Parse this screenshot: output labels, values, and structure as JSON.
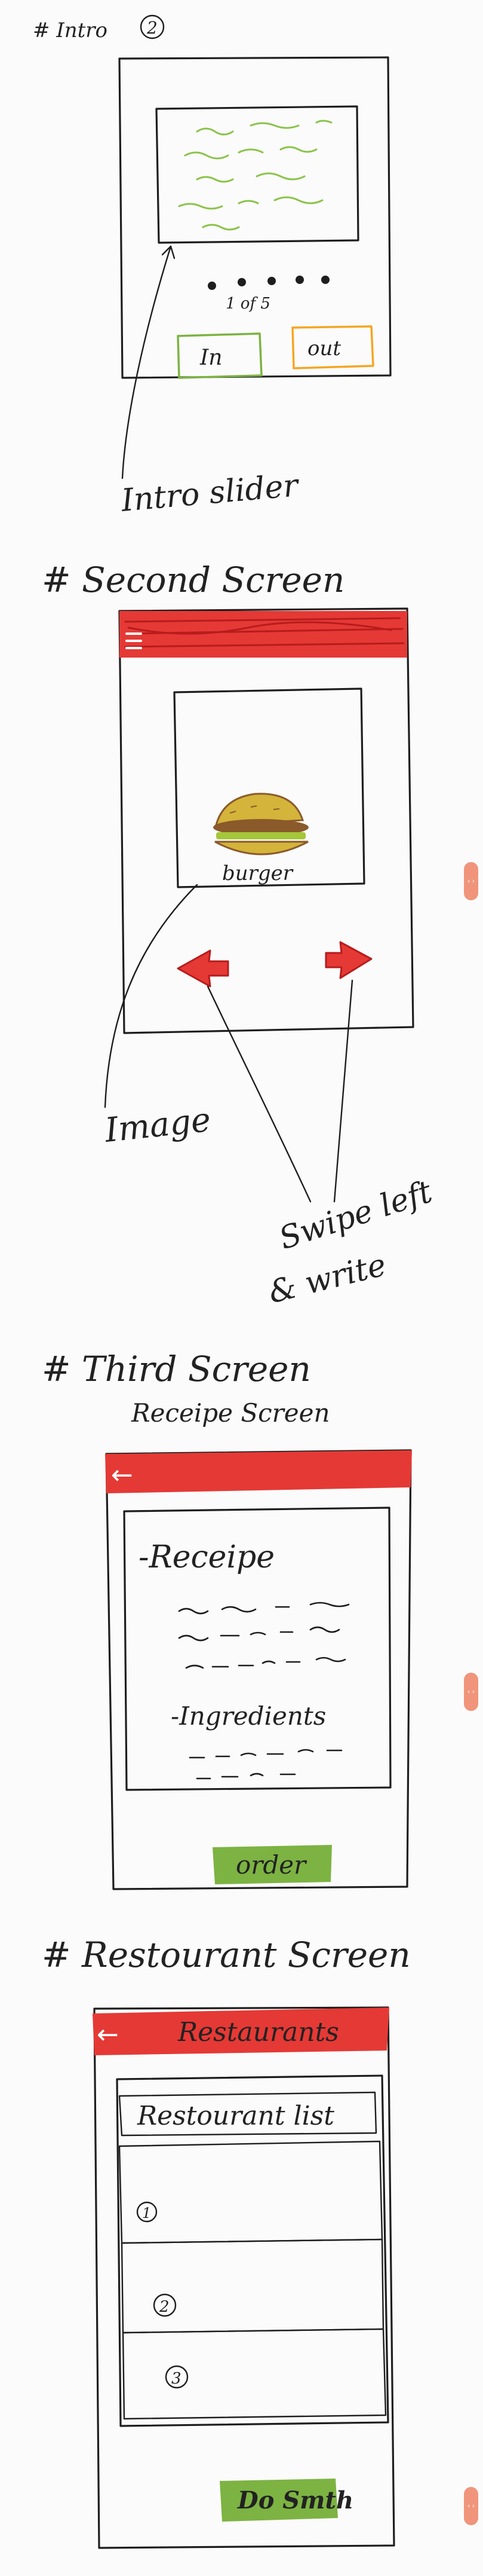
{
  "sections": {
    "intro": {
      "heading": "# Intro",
      "circled_number": "2",
      "dots_caption": "1 of 5",
      "in_button": "In",
      "out_button": "out",
      "callout": "Intro slider"
    },
    "second": {
      "heading": "# Second Screen",
      "image_caption": "burger",
      "callout_image": "Image",
      "callout_swipe_line1": "Swipe left",
      "callout_swipe_line2": "& write"
    },
    "third": {
      "heading": "# Third Screen",
      "subheading": "Receipe Screen",
      "back_arrow": "←",
      "recipe_label": "-Receipe",
      "ingredients_label": "-Ingredients",
      "order_button": "order"
    },
    "restaurant": {
      "heading": "# Restourant Screen",
      "back_arrow": "←",
      "app_bar_title": "Restaurants",
      "list_title": "Restourant list",
      "items": [
        "1",
        "2",
        "3"
      ],
      "bottom_button": "Do Smth"
    }
  },
  "colors": {
    "ink": "#1e1e1e",
    "red": "#e53935",
    "green": "#7cb342",
    "orange": "#f5a623",
    "brown": "#8a5a2b",
    "burger_yellow": "#d4b43a",
    "scroll_tab": "#f0957b"
  },
  "scroll_tabs": [
    "‹ ›",
    "‹ ›",
    "‹ ›"
  ]
}
